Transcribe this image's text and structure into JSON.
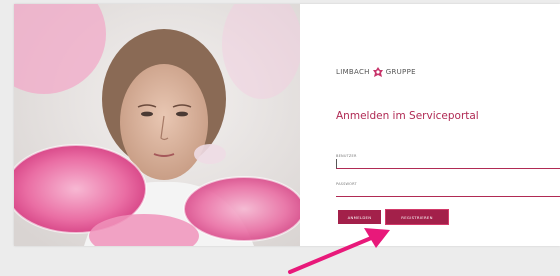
{
  "brand": {
    "name_part1": "LIMBACH",
    "name_part2": "GRUPPE",
    "accent_color": "#b02a54",
    "logo_icon": "limbach-logo-icon"
  },
  "login": {
    "title": "Anmelden im Serviceportal",
    "username_label": "BENUTZER",
    "password_label": "PASSWORT",
    "login_button": "ANMELDEN",
    "register_button": "REGISTRIEREN"
  },
  "annotation": {
    "arrow_color": "#e8197a",
    "arrow_icon": "annotation-arrow-icon"
  },
  "photo": {
    "subject": "scientist-with-petri-dishes"
  }
}
